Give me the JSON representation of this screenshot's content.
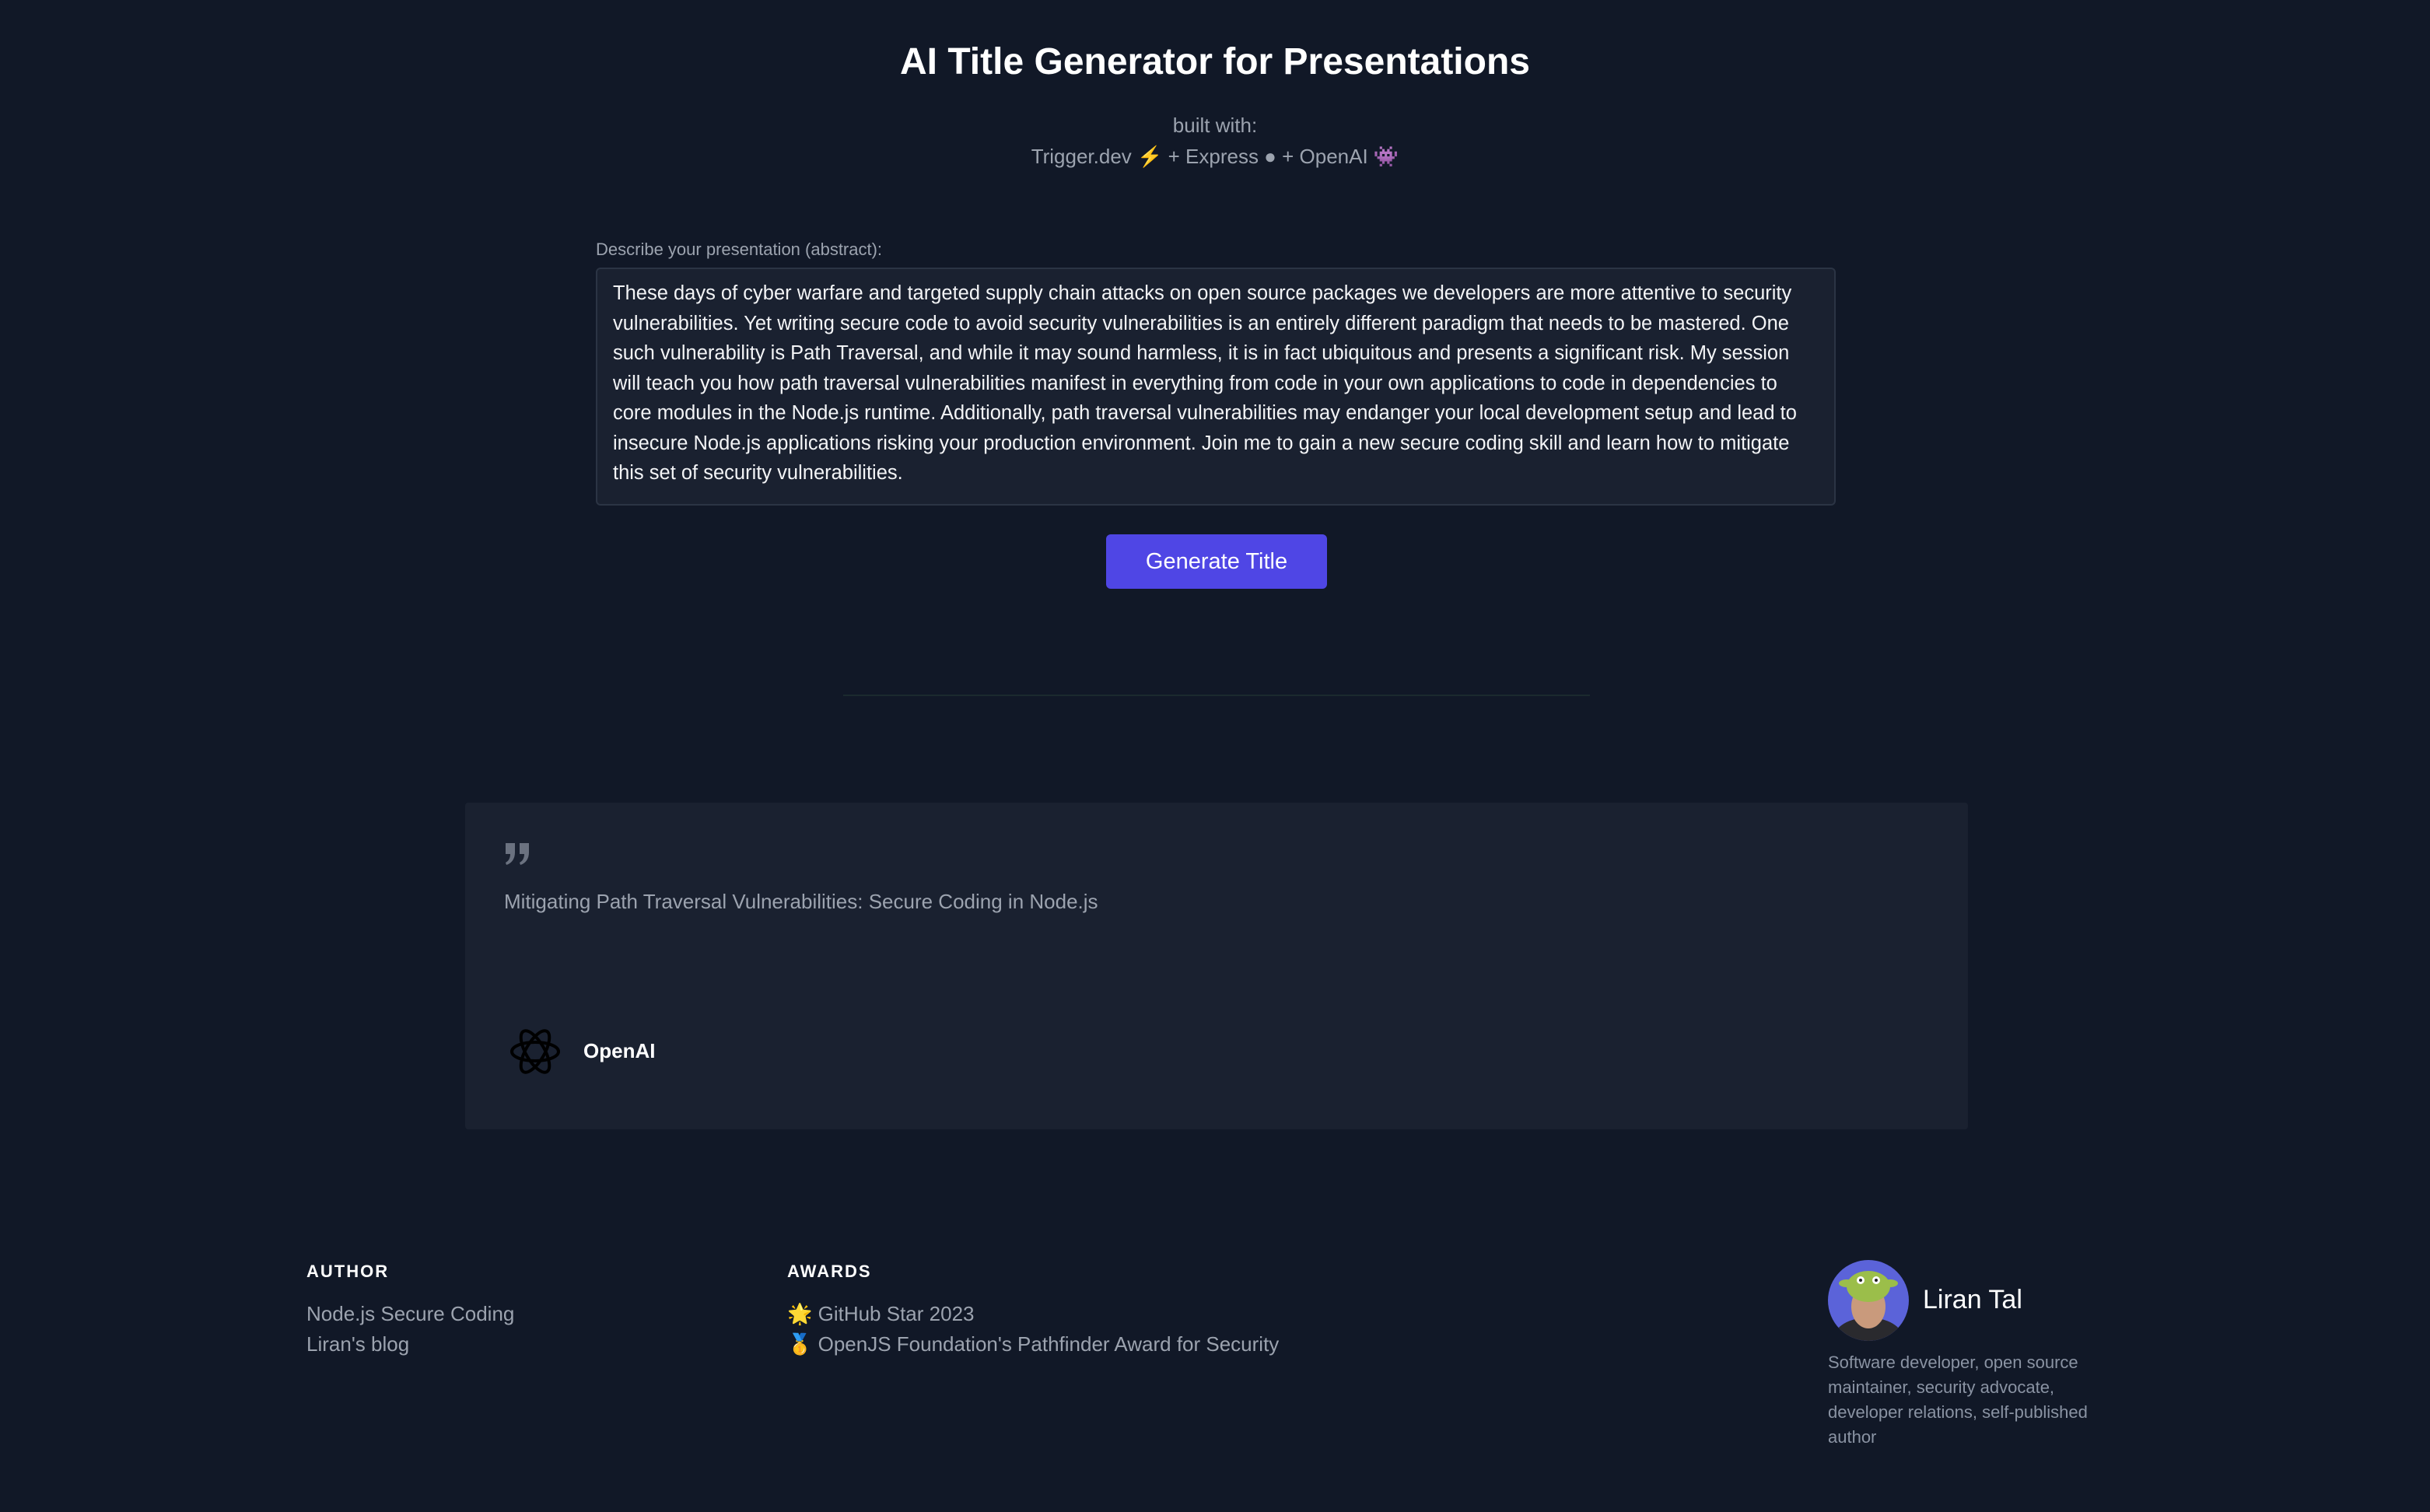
{
  "header": {
    "title": "AI Title Generator for Presentations",
    "built_with_label": "built with:",
    "stack": "Trigger.dev ⚡️ + Express ● + OpenAI 👾"
  },
  "form": {
    "label": "Describe your presentation (abstract):",
    "abstract": "These days of cyber warfare and targeted supply chain attacks on open source packages we developers are more attentive to security vulnerabilities. Yet writing secure code to avoid security vulnerabilities is an entirely different paradigm that needs to be mastered. One such vulnerability is Path Traversal, and while it may sound harmless, it is in fact ubiquitous and presents a significant risk. My session will teach you how path traversal vulnerabilities manifest in everything from code in your own applications to code in dependencies to core modules in the Node.js runtime. Additionally, path traversal vulnerabilities may endanger your local development setup and lead to insecure Node.js applications risking your production environment. Join me to gain a new secure coding skill and learn how to mitigate this set of security vulnerabilities.",
    "button_label": "Generate Title"
  },
  "result": {
    "icon": "quote-icon",
    "title": "Mitigating Path Traversal Vulnerabilities: Secure Coding in Node.js",
    "provider_icon": "openai-logo-icon",
    "provider": "OpenAI"
  },
  "footer": {
    "author_heading": "AUTHOR",
    "author_links": [
      "Node.js Secure Coding",
      "Liran's blog"
    ],
    "awards_heading": "AWARDS",
    "awards": [
      "🌟 GitHub Star 2023",
      "🥇 OpenJS Foundation's Pathfinder Award for Security"
    ],
    "profile": {
      "name": "Liran Tal",
      "bio": "Software developer, open source maintainer, security advocate, developer relations, self-published author"
    }
  },
  "colors": {
    "background": "#111827",
    "card": "#1a2130",
    "accent": "#4f46e5"
  }
}
